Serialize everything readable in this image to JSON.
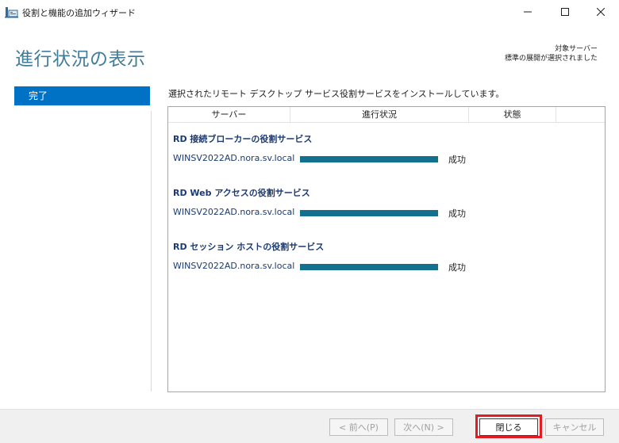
{
  "window": {
    "title": "役割と機能の追加ウィザード",
    "controls": [
      "minimize",
      "maximize",
      "close"
    ]
  },
  "header": {
    "page_title": "進行状況の表示",
    "target_label": "対象サーバー",
    "target_value": "標準の展開が選択されました"
  },
  "nav": {
    "items": [
      {
        "label": "完了",
        "selected": true
      }
    ]
  },
  "content": {
    "status_message": "選択されたリモート デスクトップ サービス役割サービスをインストールしています。",
    "columns": [
      "サーバー",
      "進行状況",
      "状態"
    ],
    "groups": [
      {
        "title": "RD 接続ブローカーの役割サービス",
        "server": "WINSV2022AD.nora.sv.local",
        "progress": 1.0,
        "status": "成功"
      },
      {
        "title": "RD Web アクセスの役割サービス",
        "server": "WINSV2022AD.nora.sv.local",
        "progress": 1.0,
        "status": "成功"
      },
      {
        "title": "RD セッション ホストの役割サービス",
        "server": "WINSV2022AD.nora.sv.local",
        "progress": 1.0,
        "status": "成功"
      }
    ]
  },
  "footer": {
    "prev_label": "< 前へ(P)",
    "next_label": "次へ(N) >",
    "close_label": "閉じる",
    "cancel_label": "キャンセル"
  },
  "colors": {
    "accent": "#0072c6",
    "title": "#3f7d99",
    "progress": "#13708f",
    "highlight": "#e11c24"
  }
}
